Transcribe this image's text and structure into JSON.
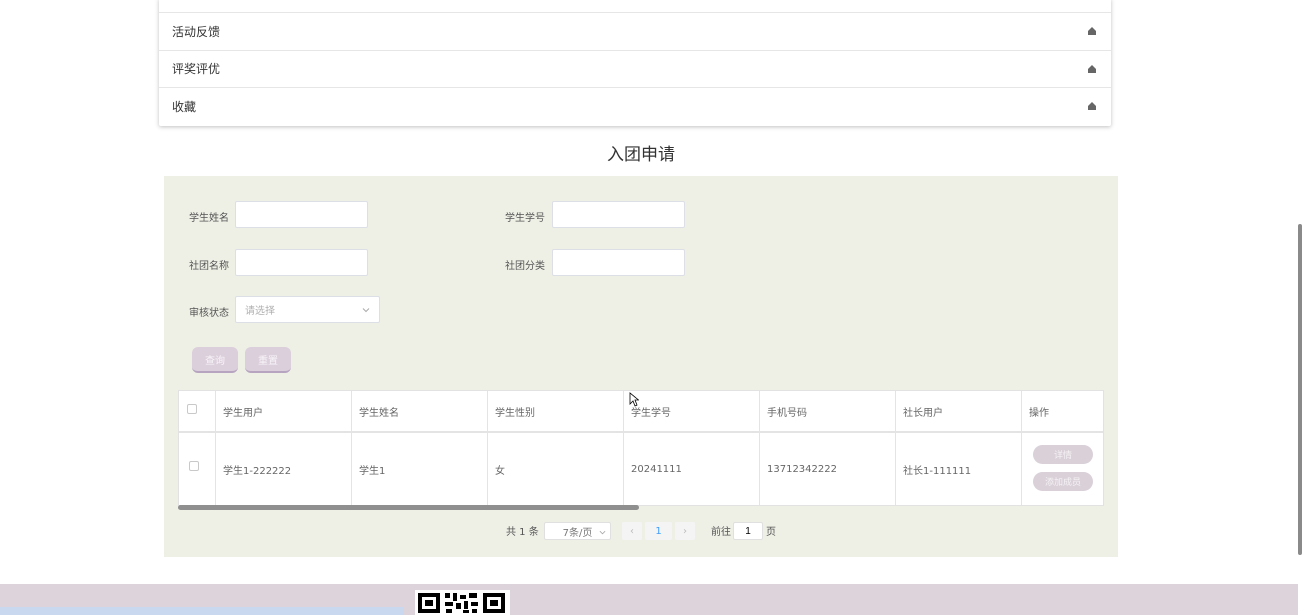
{
  "menu": {
    "items": [
      {
        "label": ""
      },
      {
        "label": "活动反馈"
      },
      {
        "label": "评奖评优"
      },
      {
        "label": "收藏"
      }
    ]
  },
  "section_title": "入团申请",
  "search": {
    "student_name_label": "学生姓名",
    "student_name_value": "",
    "student_id_label": "学生学号",
    "student_id_value": "",
    "club_name_label": "社团名称",
    "club_name_value": "",
    "club_category_label": "社团分类",
    "club_category_value": "",
    "audit_status_label": "审核状态",
    "audit_status_placeholder": "请选择",
    "query_button": "查询",
    "reset_button": "重置"
  },
  "table": {
    "headers": [
      "学生用户",
      "学生姓名",
      "学生性别",
      "学生学号",
      "手机号码",
      "社长用户",
      "操作"
    ],
    "rows": [
      {
        "student_user": "学生1-222222",
        "student_name": "学生1",
        "gender": "女",
        "student_id": "20241111",
        "phone": "13712342222",
        "president_user": "社长1-111111",
        "actions": [
          "详情",
          "添加成员"
        ]
      }
    ]
  },
  "pagination": {
    "total_text": "共 1 条",
    "page_size": "7条/页",
    "current_page": "1",
    "goto_label": "前往",
    "goto_value": "1",
    "page_suffix": "页"
  },
  "colors": {
    "search_bg": "#eef0e6",
    "button_bg": "#dbcfdc",
    "footer_bg": "#ddd3da"
  }
}
